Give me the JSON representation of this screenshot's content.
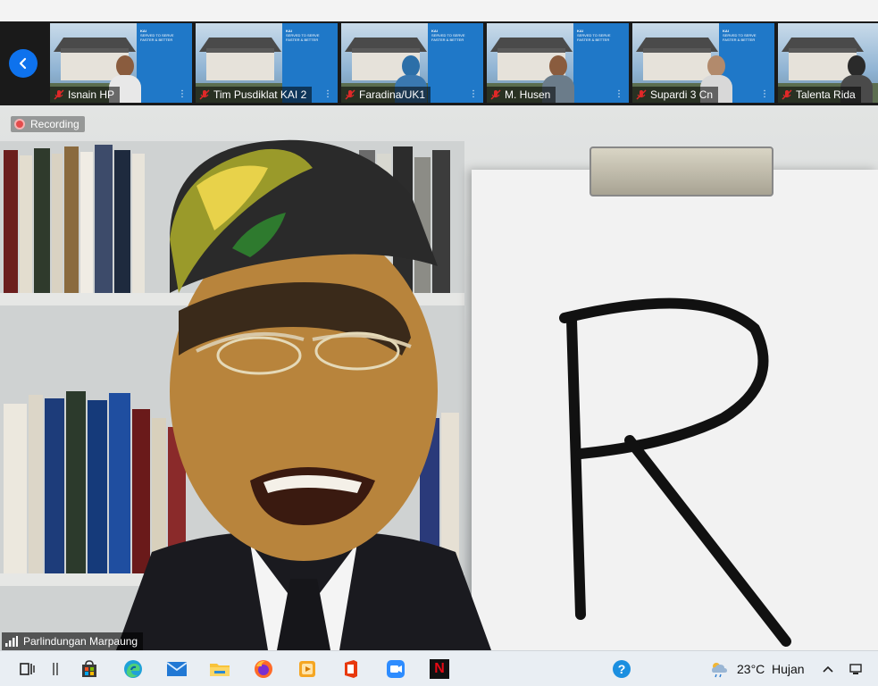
{
  "meeting": {
    "recording_label": "Recording",
    "active_speaker": "Parlindungan Marpaung",
    "participants": [
      {
        "name": "Isnain HP"
      },
      {
        "name": "Tim Pusdiklat KAI 2"
      },
      {
        "name": "Faradina/UK1"
      },
      {
        "name": "M. Husen"
      },
      {
        "name": "Supardi 3 Cn"
      },
      {
        "name": "Talenta Rida"
      }
    ],
    "banner_brand": "KAI",
    "banner_text": "SERVED TO SERVE FASTER & BETTER"
  },
  "board": {
    "letter": "R"
  },
  "taskbar": {
    "weather_temp": "23°C",
    "weather_desc": "Hujan",
    "help_glyph": "?",
    "netflix_glyph": "N"
  },
  "colors": {
    "zoom_blue": "#0e72ed",
    "mic_off_red": "#e02828",
    "recording_red": "#e44c4c"
  }
}
